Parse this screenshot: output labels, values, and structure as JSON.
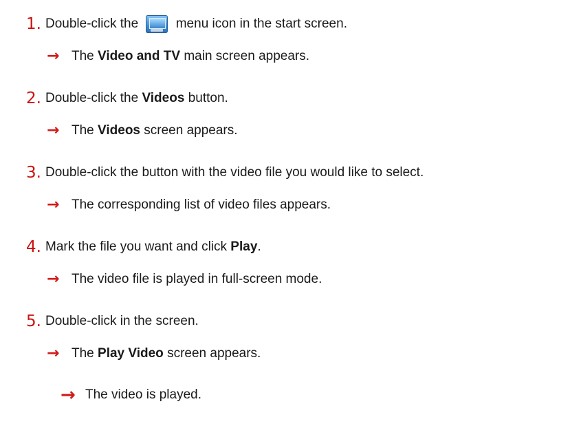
{
  "steps": [
    {
      "number": "1.",
      "text_before": "Double-click the",
      "icon": "monitor-menu-icon",
      "text_after": "menu icon in the start screen.",
      "result_prefix": "The",
      "result_bold": "Video and TV",
      "result_suffix": "main screen appears."
    },
    {
      "number": "2.",
      "text_before": "Double-click the",
      "text_bold": "Videos",
      "text_after": "button.",
      "result_prefix": "The",
      "result_bold": "Videos",
      "result_suffix": "screen appears."
    },
    {
      "number": "3.",
      "text": "Double-click the button with the video file you would like to select.",
      "result": "The corresponding list of video files appears."
    },
    {
      "number": "4.",
      "text_before": "Mark the file you want and click",
      "text_bold": "Play",
      "text_after": ".",
      "result": "The video file is played in full-screen mode."
    },
    {
      "number": "5.",
      "text": "Double-click in the screen.",
      "result_prefix": "The",
      "result_bold": "Play Video",
      "result_suffix": "screen appears."
    }
  ],
  "final_result": "The video is played.",
  "colors": {
    "step_number": "#cc1111",
    "arrow": "#d11a1a",
    "text": "#1a1a1a"
  },
  "arrow_glyph": "→"
}
